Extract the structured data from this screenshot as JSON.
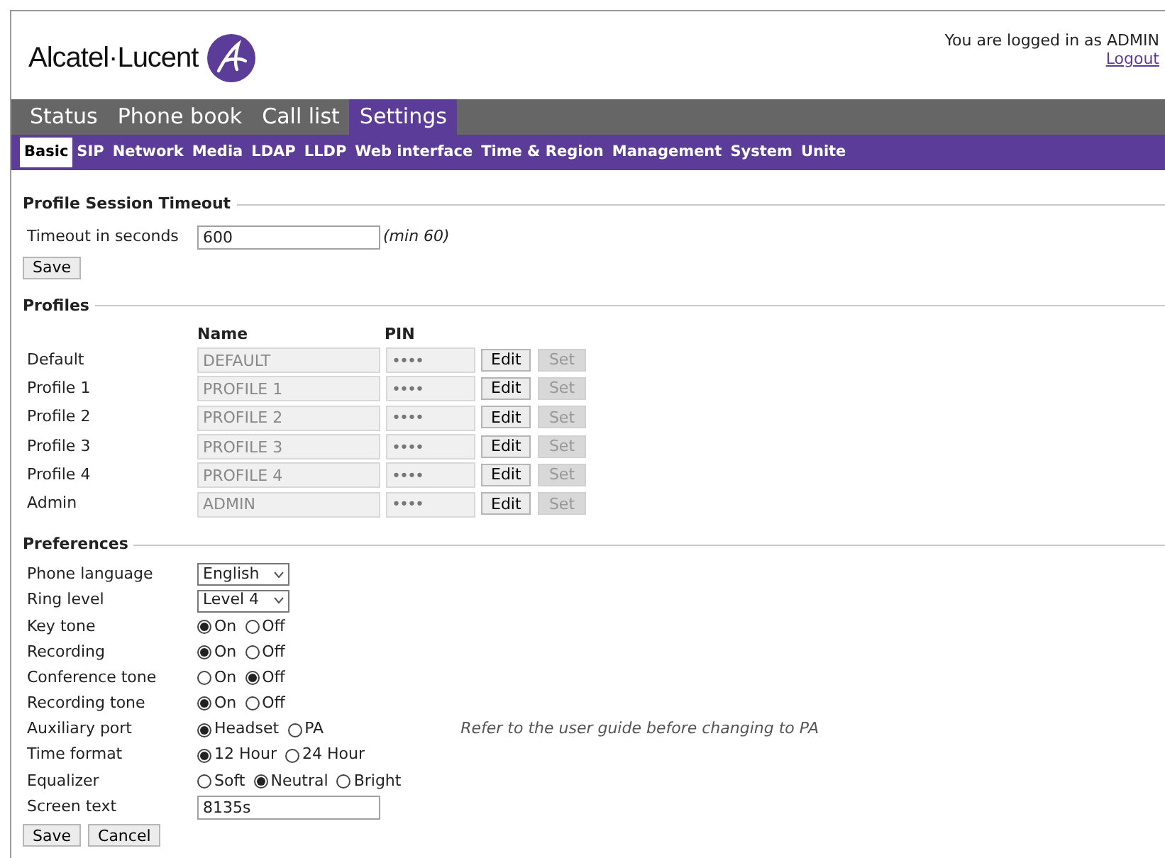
{
  "header": {
    "brand": "Alcatel·Lucent",
    "login_text": "You are logged in as ADMIN",
    "logout": "Logout"
  },
  "main_tabs": [
    {
      "label": "Status",
      "selected": false
    },
    {
      "label": "Phone book",
      "selected": false
    },
    {
      "label": "Call list",
      "selected": false
    },
    {
      "label": "Settings",
      "selected": true
    }
  ],
  "sub_tabs": [
    {
      "label": "Basic",
      "selected": true
    },
    {
      "label": "SIP",
      "selected": false
    },
    {
      "label": "Network",
      "selected": false
    },
    {
      "label": "Media",
      "selected": false
    },
    {
      "label": "LDAP",
      "selected": false
    },
    {
      "label": "LLDP",
      "selected": false
    },
    {
      "label": "Web interface",
      "selected": false
    },
    {
      "label": "Time & Region",
      "selected": false
    },
    {
      "label": "Management",
      "selected": false
    },
    {
      "label": "System",
      "selected": false
    },
    {
      "label": "Unite",
      "selected": false
    }
  ],
  "timeout_section": {
    "title": "Profile Session Timeout",
    "label": "Timeout in seconds",
    "value": "600",
    "hint": "(min 60)",
    "save": "Save"
  },
  "profiles": {
    "title": "Profiles",
    "columns": [
      "Name",
      "PIN"
    ],
    "rows": [
      {
        "label": "Default",
        "name": "DEFAULT",
        "pin": "••••",
        "edit": "Edit",
        "set": "Set",
        "set_disabled": true
      },
      {
        "label": "Profile 1",
        "name": "PROFILE 1",
        "pin": "••••",
        "edit": "Edit",
        "set": "Set",
        "set_disabled": true
      },
      {
        "label": "Profile 2",
        "name": "PROFILE 2",
        "pin": "••••",
        "edit": "Edit",
        "set": "Set",
        "set_disabled": true
      },
      {
        "label": "Profile 3",
        "name": "PROFILE 3",
        "pin": "••••",
        "edit": "Edit",
        "set": "Set",
        "set_disabled": true
      },
      {
        "label": "Profile 4",
        "name": "PROFILE 4",
        "pin": "••••",
        "edit": "Edit",
        "set": "Set",
        "set_disabled": true
      },
      {
        "label": "Admin",
        "name": "ADMIN",
        "pin": "••••",
        "edit": "Edit",
        "set": "Set",
        "set_disabled": true
      }
    ]
  },
  "preferences": {
    "title": "Preferences",
    "rows": [
      {
        "kind": "select",
        "label": "Phone language",
        "value": "English"
      },
      {
        "kind": "select",
        "label": "Ring level",
        "value": "Level 4"
      },
      {
        "kind": "radio",
        "label": "Key tone",
        "options": [
          {
            "label": "On",
            "selected": true
          },
          {
            "label": "Off",
            "selected": false
          }
        ]
      },
      {
        "kind": "radio",
        "label": "Recording",
        "options": [
          {
            "label": "On",
            "selected": true
          },
          {
            "label": "Off",
            "selected": false
          }
        ]
      },
      {
        "kind": "radio",
        "label": "Conference tone",
        "options": [
          {
            "label": "On",
            "selected": false
          },
          {
            "label": "Off",
            "selected": true
          }
        ]
      },
      {
        "kind": "radio",
        "label": "Recording tone",
        "options": [
          {
            "label": "On",
            "selected": true
          },
          {
            "label": "Off",
            "selected": false
          }
        ]
      },
      {
        "kind": "radio",
        "label": "Auxiliary port",
        "options": [
          {
            "label": "Headset",
            "selected": true
          },
          {
            "label": "PA",
            "selected": false
          }
        ],
        "note": "Refer to the user guide before changing to PA"
      },
      {
        "kind": "radio",
        "label": "Time format",
        "options": [
          {
            "label": "12 Hour",
            "selected": true
          },
          {
            "label": "24 Hour",
            "selected": false
          }
        ]
      },
      {
        "kind": "radio",
        "label": "Equalizer",
        "options": [
          {
            "label": "Soft",
            "selected": false
          },
          {
            "label": "Neutral",
            "selected": true
          },
          {
            "label": "Bright",
            "selected": false
          }
        ]
      },
      {
        "kind": "text",
        "label": "Screen text",
        "value": "8135s"
      }
    ],
    "buttons": [
      "Save",
      "Cancel"
    ]
  }
}
